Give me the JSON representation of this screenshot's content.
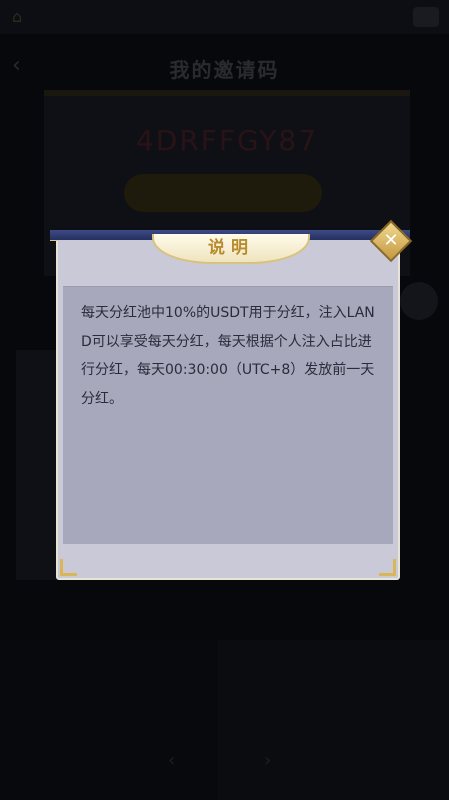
{
  "background": {
    "home_icon": "home-icon",
    "menu_icon": "menu-icon",
    "back_icon": "chevron-left-icon",
    "page_title": "我的邀请码",
    "invite_code": "4DRFFGY87",
    "bottom_arrows": [
      "‹",
      "›"
    ]
  },
  "modal": {
    "title": "说明",
    "close_icon": "close-icon",
    "content": "每天分红池中10%的USDT用于分红，注入LAND可以享受每天分红，每天根据个人注入占比进行分红，每天00:30:00（UTC+8）发放前一天分红。"
  },
  "colors": {
    "title_gold": "#b88b2c",
    "modal_bg": "#c9c9d8",
    "content_bg": "#a8a8bc",
    "header_bar": "#2e3a70"
  }
}
